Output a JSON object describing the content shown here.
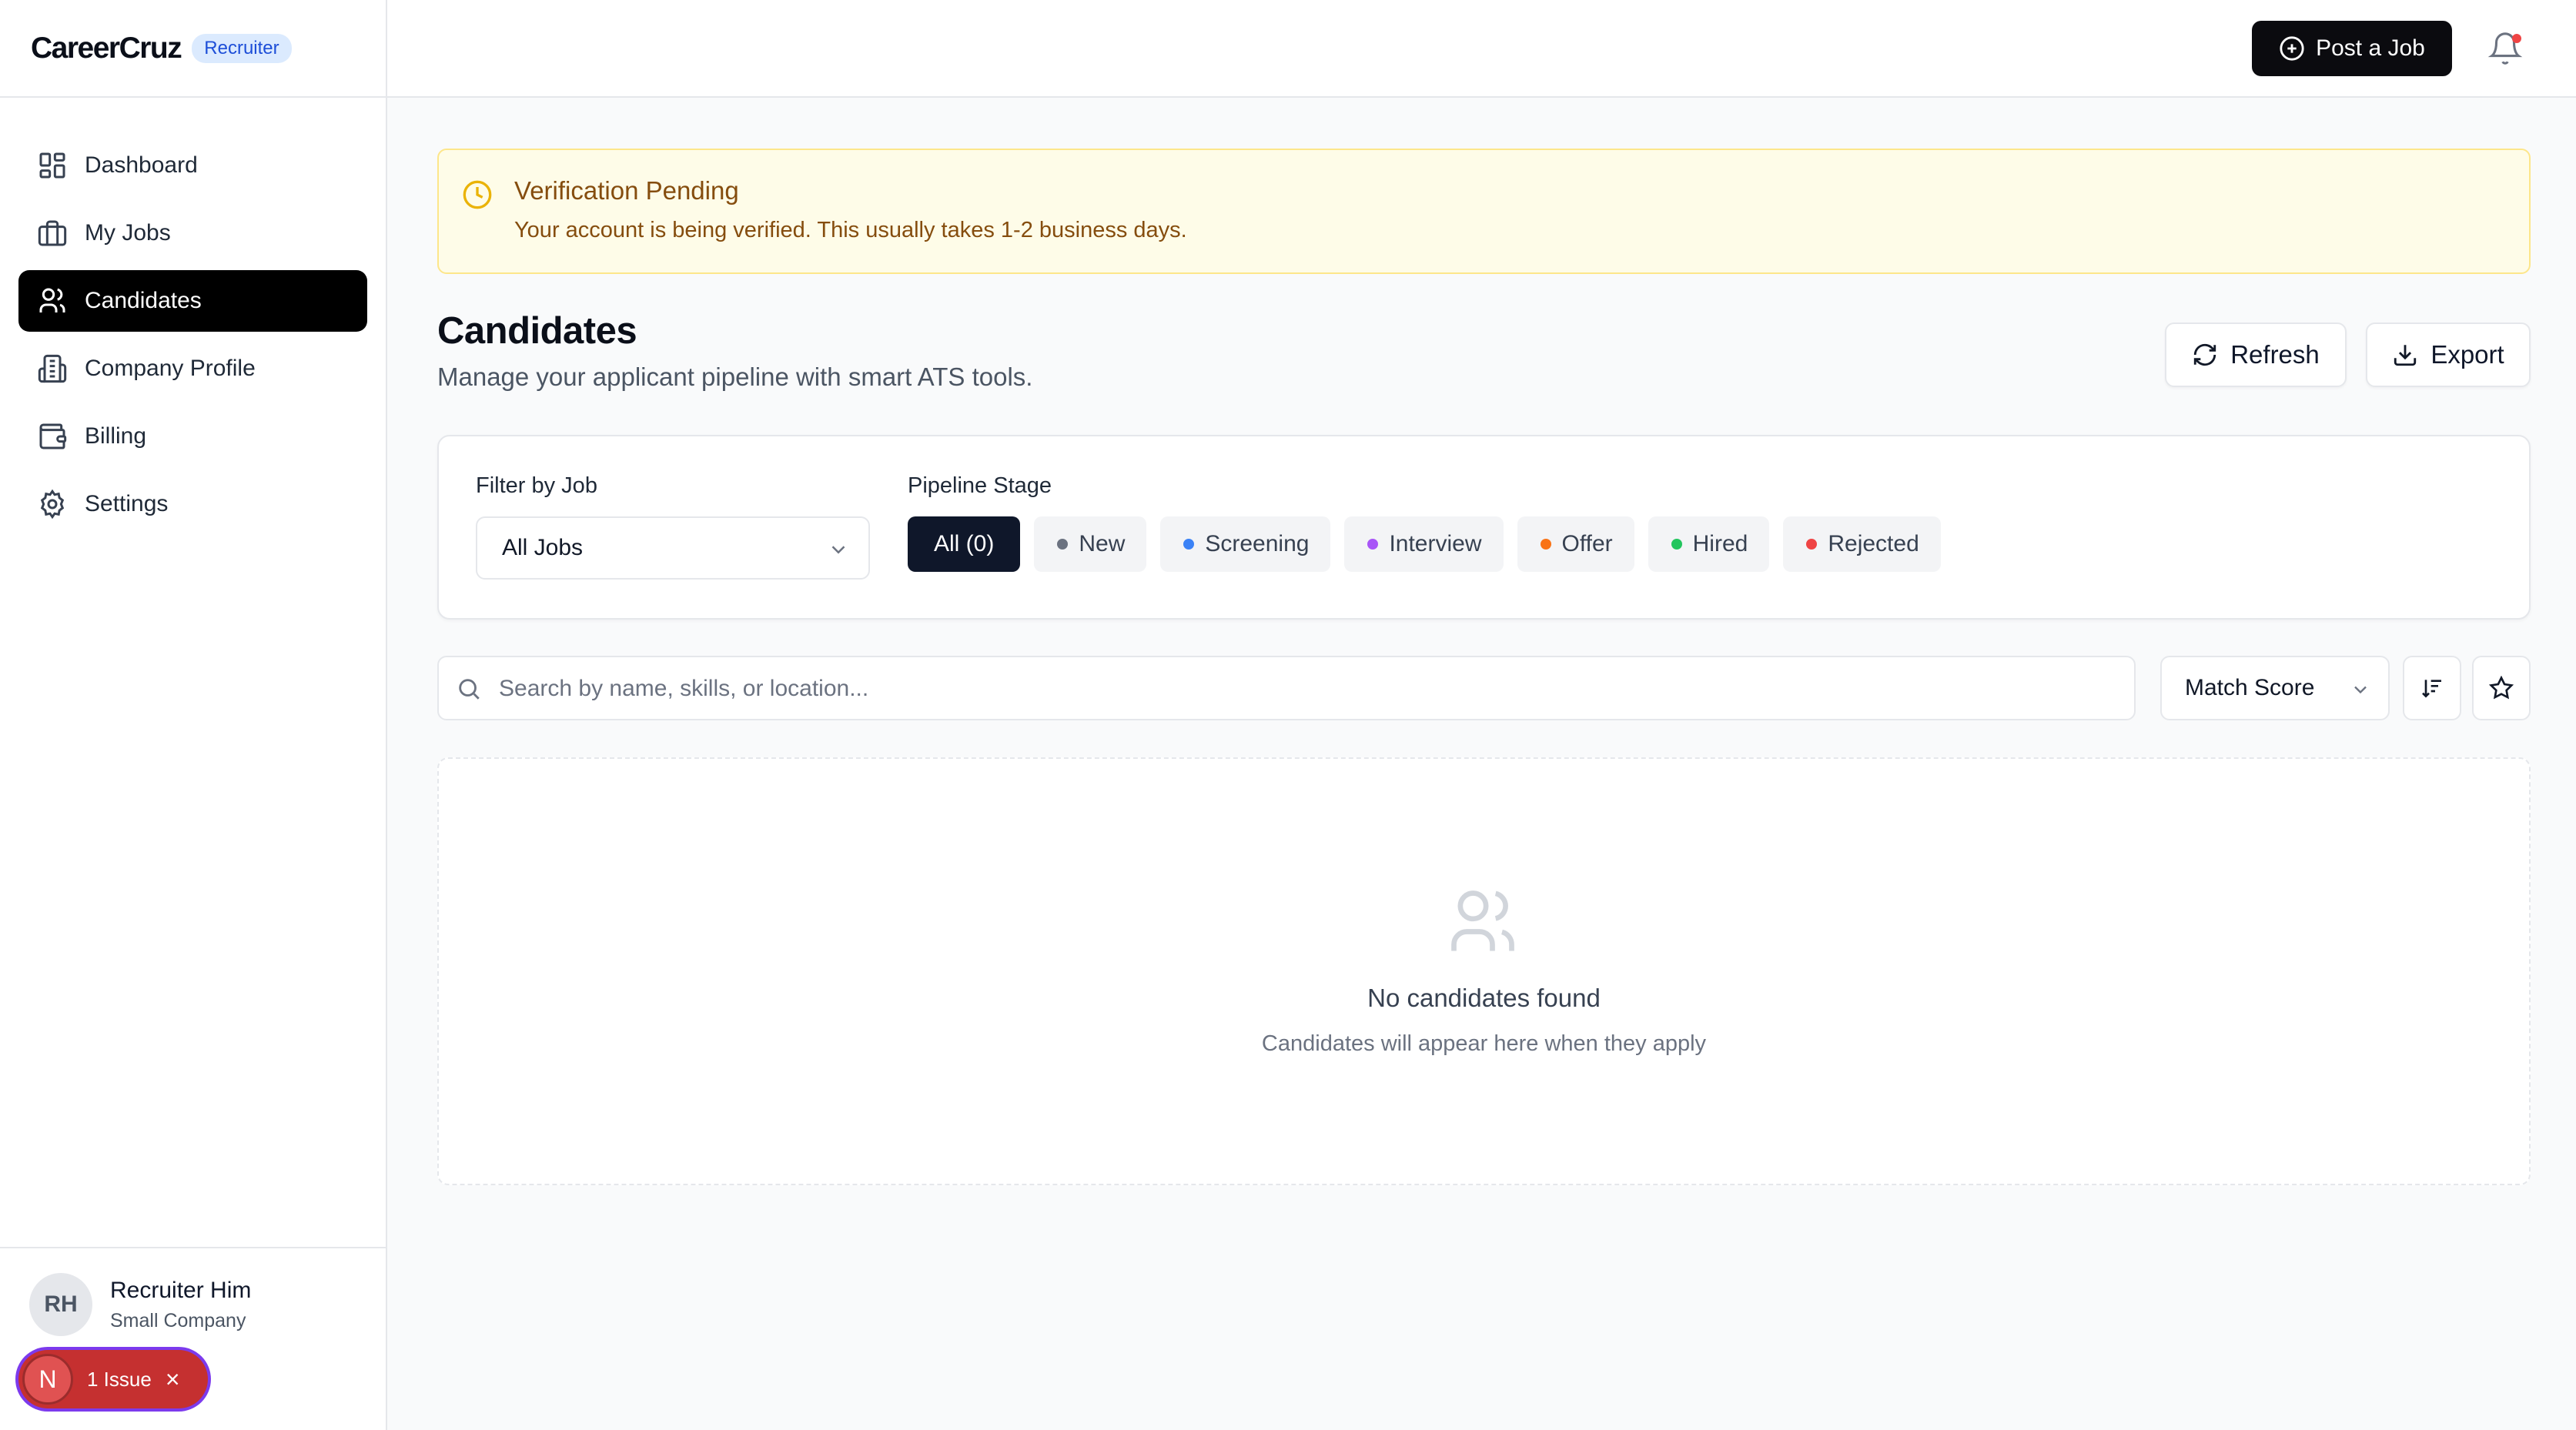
{
  "brand": {
    "name": "CareerCruz",
    "badge": "Recruiter"
  },
  "sidebar": {
    "items": [
      {
        "label": "Dashboard",
        "icon": "dashboard-icon",
        "active": false
      },
      {
        "label": "My Jobs",
        "icon": "briefcase-icon",
        "active": false
      },
      {
        "label": "Candidates",
        "icon": "users-icon",
        "active": true
      },
      {
        "label": "Company Profile",
        "icon": "building-icon",
        "active": false
      },
      {
        "label": "Billing",
        "icon": "wallet-icon",
        "active": false
      },
      {
        "label": "Settings",
        "icon": "gear-icon",
        "active": false
      }
    ]
  },
  "user": {
    "initials": "RH",
    "name": "Recruiter Him",
    "company": "Small Company"
  },
  "issues": {
    "avatar_letter": "N",
    "label": "1 Issue"
  },
  "header": {
    "post_job_label": "Post a Job"
  },
  "alert": {
    "title": "Verification Pending",
    "message": "Your account is being verified. This usually takes 1-2 business days."
  },
  "page": {
    "title": "Candidates",
    "subtitle": "Manage your applicant pipeline with smart ATS tools.",
    "refresh_label": "Refresh",
    "export_label": "Export"
  },
  "filters": {
    "job_label": "Filter by Job",
    "job_value": "All Jobs",
    "stage_label": "Pipeline Stage",
    "stages": [
      {
        "label": "All (0)",
        "color": null,
        "active": true
      },
      {
        "label": "New",
        "color": "#6b7280",
        "active": false
      },
      {
        "label": "Screening",
        "color": "#3b82f6",
        "active": false
      },
      {
        "label": "Interview",
        "color": "#a855f7",
        "active": false
      },
      {
        "label": "Offer",
        "color": "#f97316",
        "active": false
      },
      {
        "label": "Hired",
        "color": "#22c55e",
        "active": false
      },
      {
        "label": "Rejected",
        "color": "#ef4444",
        "active": false
      }
    ]
  },
  "search": {
    "placeholder": "Search by name, skills, or location...",
    "value": ""
  },
  "sort": {
    "value": "Match Score"
  },
  "empty": {
    "title": "No candidates found",
    "subtitle": "Candidates will appear here when they apply"
  },
  "colors": {
    "accent": "#000000",
    "alert_bg": "#fefce8",
    "alert_text": "#854d0e"
  }
}
